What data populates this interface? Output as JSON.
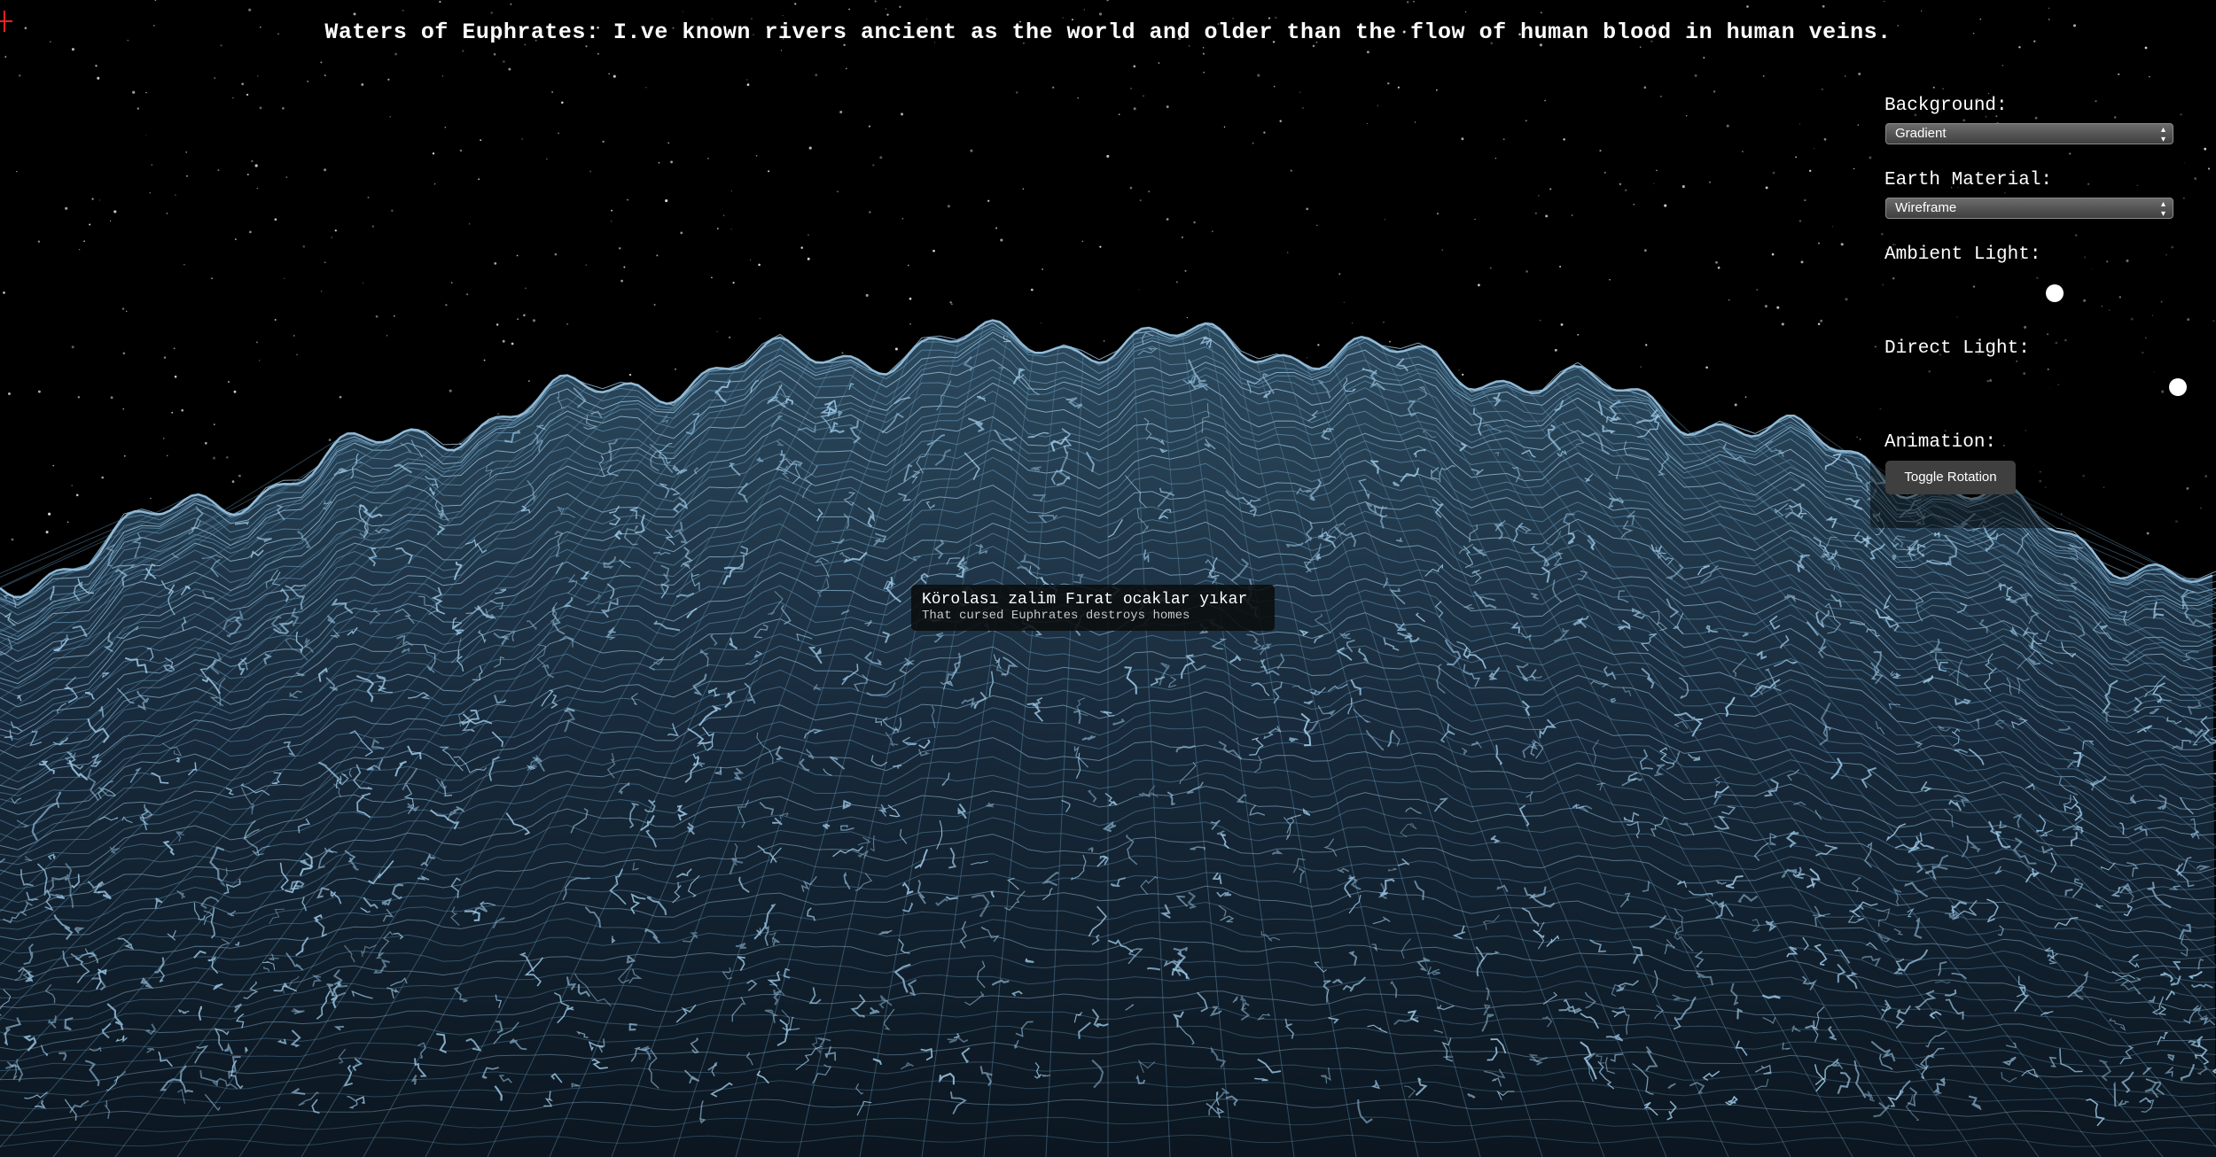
{
  "header": {
    "title": "Waters of Euphrates: I.ve known rivers ancient as the world and older than the flow of human blood in human veins."
  },
  "controls": {
    "background": {
      "label": "Background:",
      "selected": "Gradient"
    },
    "earth_material": {
      "label": "Earth Material:",
      "selected": "Wireframe"
    },
    "ambient_light": {
      "label": "Ambient Light:",
      "value": 0.58
    },
    "direct_light": {
      "label": "Direct Light:",
      "value": 1.0
    },
    "animation": {
      "label": "Animation:",
      "toggle_label": "Toggle Rotation"
    }
  },
  "tooltip": {
    "title": "Körolası zalim Fırat ocaklar yıkar",
    "subtitle": "That cursed Euphrates destroys homes"
  },
  "colors": {
    "background": "#000000",
    "wireframe": "#9cc8e6",
    "wireframe_dim": "#5f8fb0",
    "crosshair": "#ff2020"
  },
  "icons": {
    "select_chevron": "chevron-updown-icon",
    "crosshair": "crosshair-icon"
  }
}
